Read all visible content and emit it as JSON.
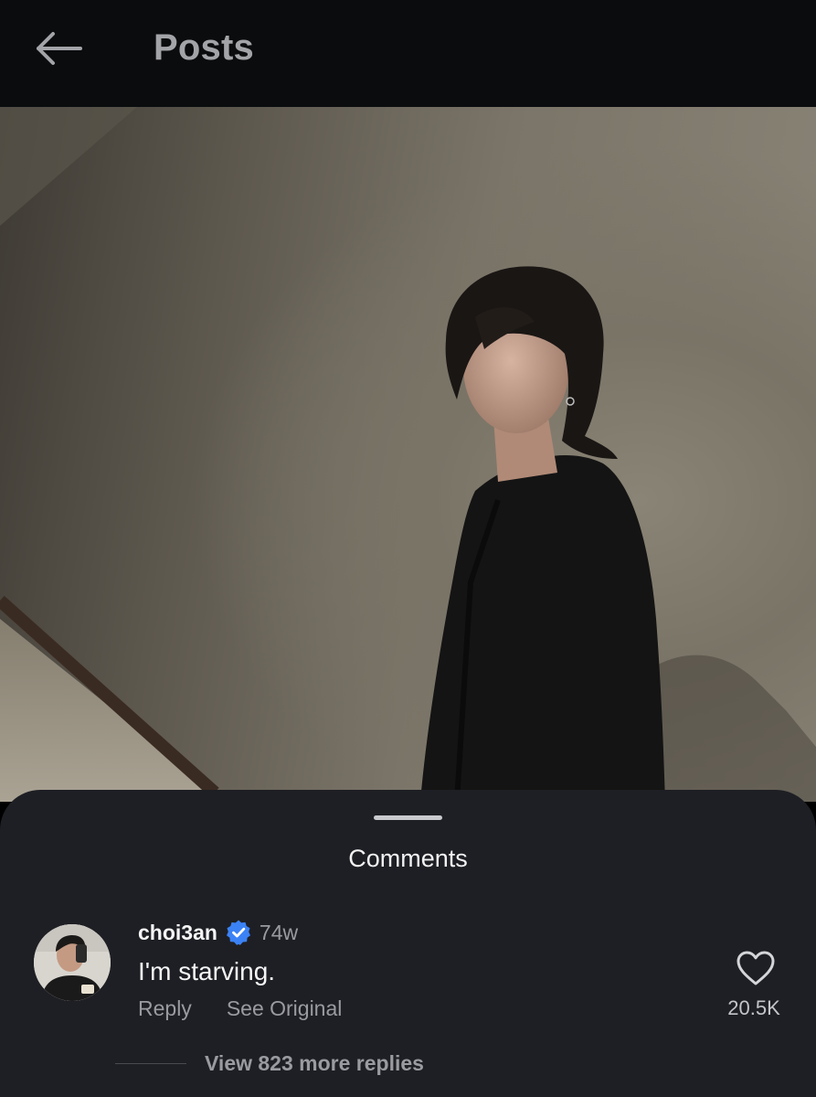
{
  "header": {
    "title": "Posts",
    "back_icon": "arrow-left-icon"
  },
  "post_image": {
    "description": "photo"
  },
  "comments_sheet": {
    "title": "Comments",
    "comment": {
      "username": "choi3an",
      "verified": true,
      "verified_color": "#3b82f6",
      "timestamp": "74w",
      "text": "I'm starving.",
      "reply_label": "Reply",
      "see_original_label": "See Original",
      "like_count": "20.5K",
      "view_replies_label": "View 823 more replies"
    }
  }
}
